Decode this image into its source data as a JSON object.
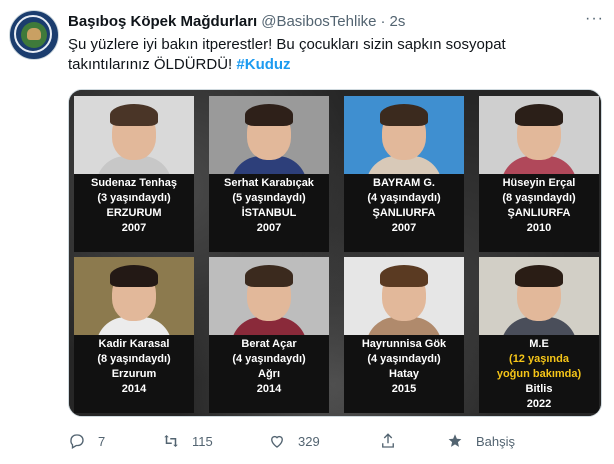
{
  "tweet": {
    "display_name": "Başıboş Köpek Mağdurları",
    "handle": "@BasibosTehlike",
    "separator": "·",
    "time": "2s",
    "more": "···",
    "text_part1": "Şu yüzlere iyi bakın itperestler! Bu çocukları sizin sapkın sosyopat takıntılarınız ÖLDÜRDÜ! ",
    "hashtag": "#Kuduz"
  },
  "cards": [
    {
      "line1": "Sudenaz Tenhaş",
      "line2": "(3 yaşındaydı)",
      "line3": "ERZURUM",
      "line4": "2007",
      "photo_bg": "#d9d9d9",
      "shirt": "#c7c7c7",
      "hair": "#4a3527"
    },
    {
      "line1": "Serhat Karabıçak",
      "line2": "(5 yaşındaydı)",
      "line3": "İSTANBUL",
      "line4": "2007",
      "photo_bg": "#9a9a9a",
      "shirt": "#2d3f7a",
      "hair": "#2e2019"
    },
    {
      "line1": "BAYRAM G.",
      "line2": "(4 yaşındaydı)",
      "line3": "ŞANLIURFA",
      "line4": "2007",
      "photo_bg": "#3f8fd0",
      "shirt": "#d8c9b8",
      "hair": "#3b2a1e"
    },
    {
      "line1": "Hüseyin Erçal",
      "line2": "(8 yaşındaydı)",
      "line3": "ŞANLIURFA",
      "line4": "2010",
      "photo_bg": "#cfcfcf",
      "shirt": "#b0485a",
      "hair": "#2b1f18"
    },
    {
      "line1": "Kadir Karasal",
      "line2": "(8 yaşındaydı)",
      "line3": "Erzurum",
      "line4": "2014",
      "photo_bg": "#8c7a4e",
      "shirt": "#ececec",
      "hair": "#231915"
    },
    {
      "line1": "Berat Açar",
      "line2": "(4 yaşındaydı)",
      "line3": "Ağrı",
      "line4": "2014",
      "photo_bg": "#bdbdbd",
      "shirt": "#8a2a3a",
      "hair": "#3b2a1e"
    },
    {
      "line1": "Hayrunnisa Gök",
      "line2": "(4 yaşındaydı)",
      "line3": "Hatay",
      "line4": "2015",
      "photo_bg": "#e6e6e6",
      "shirt": "#b08a6c",
      "hair": "#5a3a22"
    },
    {
      "line1": "M.E",
      "line2": "(12 yaşında",
      "line3": "yoğun bakımda)",
      "line4": "Bitlis",
      "line5": "2022",
      "photo_bg": "#d2cfc6",
      "shirt": "#4a4e5a",
      "hair": "#2a1d15"
    }
  ],
  "actions": {
    "reply_count": "7",
    "retweet_count": "115",
    "like_count": "329",
    "tip_label": "Bahşiş"
  },
  "colors": {
    "link": "#1d9bf0",
    "muted": "#536471",
    "highlight": "#f5c518"
  }
}
